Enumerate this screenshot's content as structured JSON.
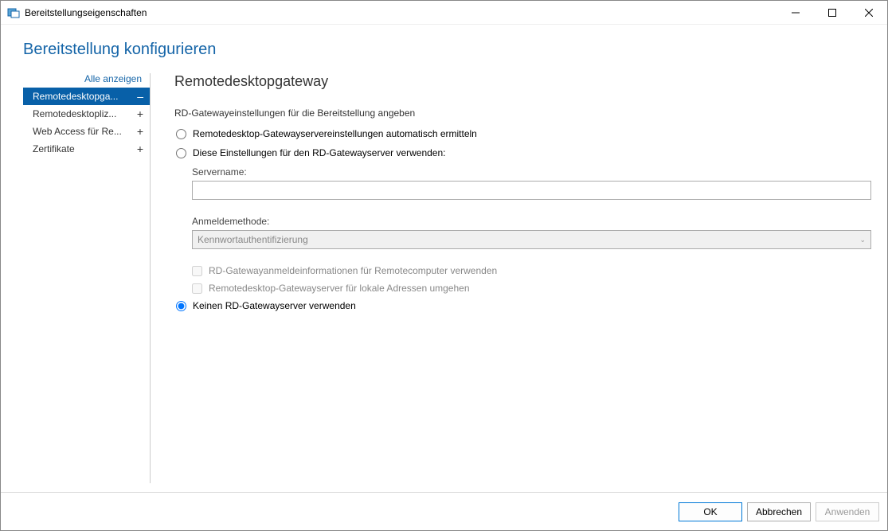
{
  "window": {
    "title": "Bereitstellungseigenschaften"
  },
  "heading": "Bereitstellung konfigurieren",
  "sidebar": {
    "show_all": "Alle anzeigen",
    "items": [
      {
        "label": "Remotedesktopga...",
        "indicator": "–"
      },
      {
        "label": "Remotedesktopliz...",
        "indicator": "+"
      },
      {
        "label": "Web Access für Re...",
        "indicator": "+"
      },
      {
        "label": "Zertifikate",
        "indicator": "+"
      }
    ]
  },
  "main": {
    "title": "Remotedesktopgateway",
    "subtitle": "RD-Gatewayeinstellungen für die Bereitstellung angeben",
    "radio_auto": "Remotedesktop-Gatewayservereinstellungen automatisch ermitteln",
    "radio_use": "Diese Einstellungen für den RD-Gatewayserver verwenden:",
    "radio_none": "Keinen RD-Gatewayserver verwenden",
    "servername_label": "Servername:",
    "servername_value": "",
    "loginmethod_label": "Anmeldemethode:",
    "loginmethod_value": "Kennwortauthentifizierung",
    "check_credentials": "RD-Gatewayanmeldeinformationen für Remotecomputer verwenden",
    "check_bypass": "Remotedesktop-Gatewayserver für lokale Adressen umgehen"
  },
  "footer": {
    "ok": "OK",
    "cancel": "Abbrechen",
    "apply": "Anwenden"
  }
}
